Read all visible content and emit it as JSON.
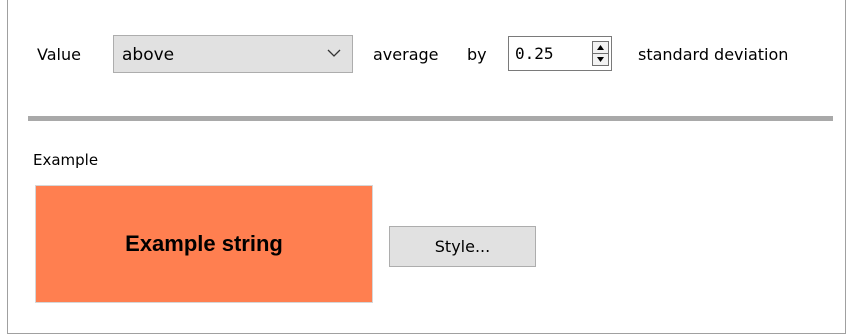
{
  "condition": {
    "value_label": "Value",
    "comparison": {
      "selected": "above"
    },
    "average_by_label": "average",
    "by_label": "by",
    "deviation": {
      "value": "0.25"
    },
    "unit_label": "standard deviation"
  },
  "example": {
    "label": "Example",
    "sample_text": "Example string",
    "sample_background": "#ff7f50",
    "style_button_label": "Style..."
  },
  "icons": {
    "combo_arrow": "chevron-down-icon",
    "spin_up": "triangle-up-icon",
    "spin_down": "triangle-down-icon"
  }
}
